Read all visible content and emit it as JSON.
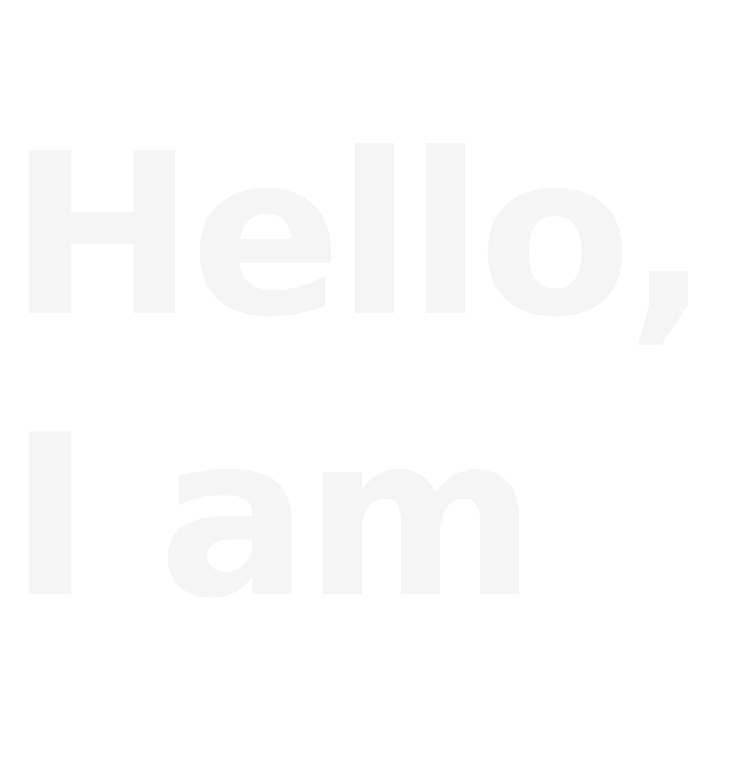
{
  "hero": {
    "line1": "Hello,",
    "line2": "I am"
  },
  "colors": {
    "background": "#ffffff",
    "text": "#f5f5f5"
  }
}
